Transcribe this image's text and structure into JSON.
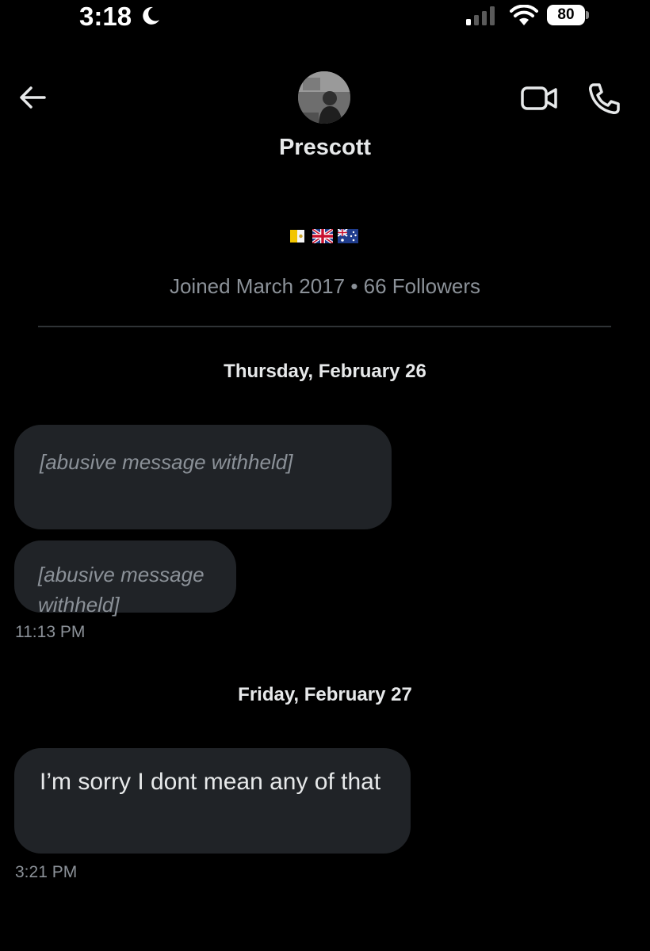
{
  "status_bar": {
    "time": "3:18",
    "battery": "80",
    "icons": [
      "moon-icon",
      "signal-icon",
      "wifi-icon",
      "battery-icon"
    ]
  },
  "header": {
    "icons": [
      "back-arrow-icon",
      "video-call-icon",
      "phone-call-icon"
    ]
  },
  "profile": {
    "name": "Prescott",
    "flags": [
      "vatican-flag-icon",
      "uk-flag-icon",
      "australia-flag-icon"
    ],
    "meta": "Joined March 2017 • 66 Followers"
  },
  "conversation": {
    "groups": [
      {
        "date": "Thursday, February 26",
        "messages": [
          {
            "text": "[abusive message withheld]"
          },
          {
            "text": "[abusive message withheld]"
          }
        ],
        "time": "11:13 PM"
      },
      {
        "date": "Friday, February 27",
        "messages": [
          {
            "text": "I’m sorry I dont mean any of that"
          }
        ],
        "time": "3:21 PM"
      }
    ]
  },
  "colors": {
    "background": "#000000",
    "bubble": "#202327",
    "text": "#e7e9ea",
    "secondary_text": "#8b9198",
    "divider": "#2f3336"
  }
}
